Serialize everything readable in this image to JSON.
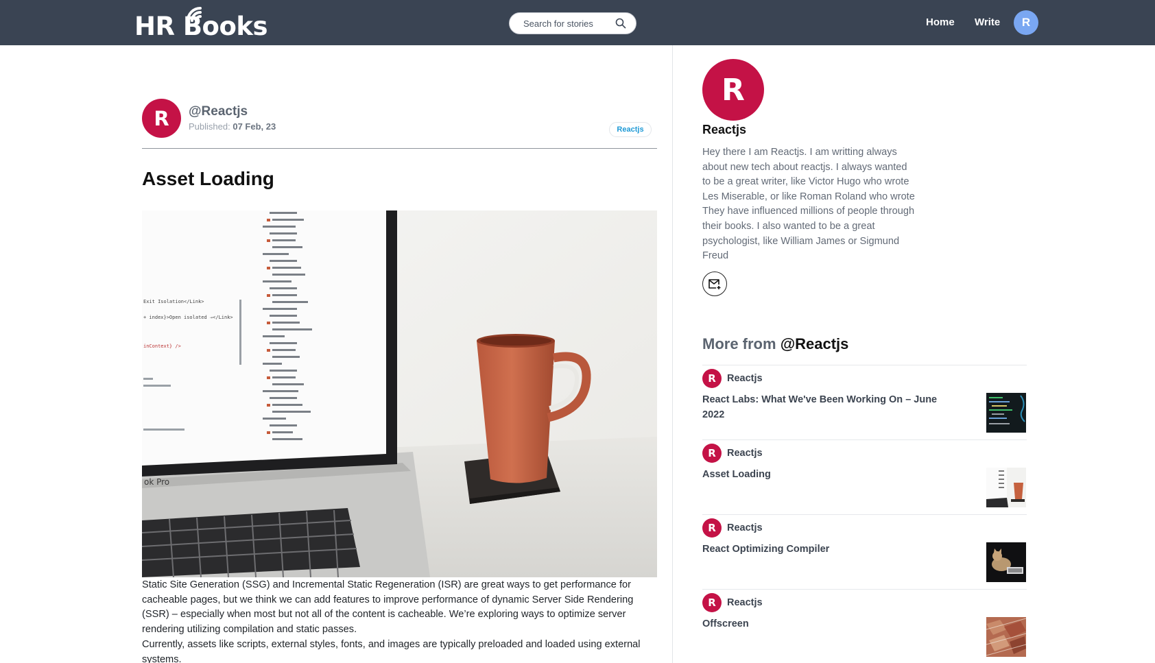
{
  "header": {
    "logo_text": "HR Books",
    "search_placeholder": "Search for stories",
    "nav": {
      "home": "Home",
      "write": "Write"
    },
    "user_initial": "R"
  },
  "article": {
    "author_initial": "R",
    "author_handle": "@Reactjs",
    "published_label": "Published:",
    "published_date": "07 Feb, 23",
    "tag": "Reactjs",
    "title": "Asset Loading",
    "paragraphs": [
      "Static Site Generation (SSG) and Incremental Static Regeneration (ISR) are great ways to get performance for cacheable pages, but we think we can add features to improve performance of dynamic Server Side Rendering (SSR) – especially when most but not all of the content is cacheable. We’re exploring ways to optimize server rendering utilizing compilation and static passes.",
      "Currently, assets like scripts, external styles, fonts, and images are typically preloaded and loaded using external systems."
    ],
    "screen_labels": [
      "Exit Isolation</Link>",
      "+ index}>Open isolated ⇢</Link>",
      "inContext} />",
      "ok Pro"
    ]
  },
  "sidebar": {
    "profile_initial": "R",
    "profile_name": "Reactjs",
    "bio": "Hey there I am Reactjs. I am writting always about new tech about reactjs. I always wanted to be a great writer, like Victor Hugo who wrote Les Miserable, or like Roman Roland who wrote They have influenced millions of people through their books. I also wanted to be a great psychologist, like William James or Sigmund Freud",
    "more_label": "More from",
    "more_handle": "@Reactjs",
    "more_items": [
      {
        "initial": "R",
        "author": "Reactjs",
        "title": "React Labs: What We've Been Working On – June 2022"
      },
      {
        "initial": "R",
        "author": "Reactjs",
        "title": "Asset Loading"
      },
      {
        "initial": "R",
        "author": "Reactjs",
        "title": "React Optimizing Compiler"
      },
      {
        "initial": "R",
        "author": "Reactjs",
        "title": "Offscreen"
      }
    ]
  },
  "colors": {
    "header_bg": "#3a4453",
    "avatar_red": "#c41246",
    "user_avatar_blue": "#7aa7f2",
    "tag_blue": "#1f9ad6"
  },
  "icons": [
    "search-icon",
    "wifi-signal-icon",
    "mail-plus-icon"
  ]
}
